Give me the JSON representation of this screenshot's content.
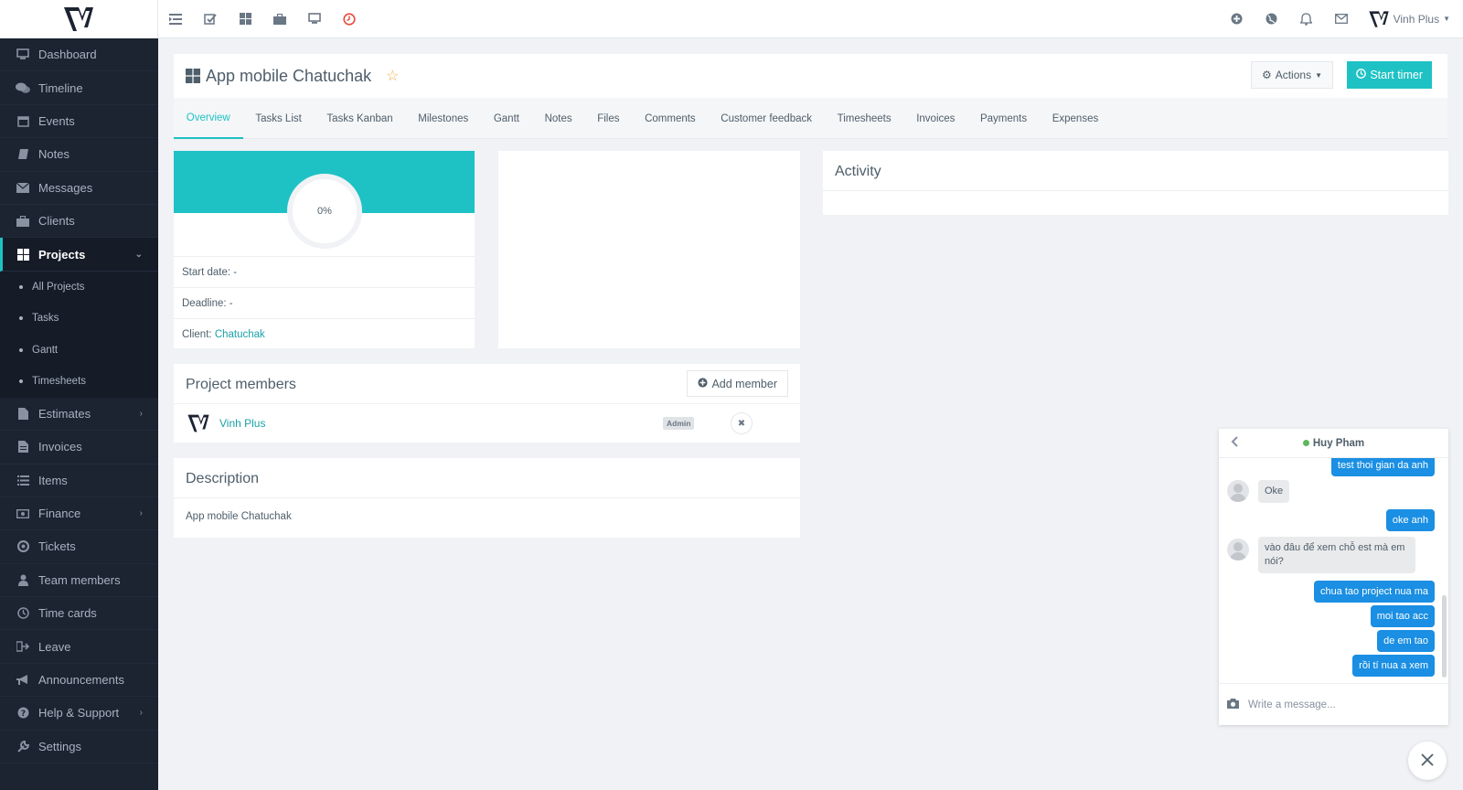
{
  "user": {
    "name": "Vinh Plus"
  },
  "sidebar": {
    "items": [
      {
        "label": "Dashboard",
        "icon": "monitor-icon"
      },
      {
        "label": "Timeline",
        "icon": "comments-icon"
      },
      {
        "label": "Events",
        "icon": "calendar-icon"
      },
      {
        "label": "Notes",
        "icon": "book-icon"
      },
      {
        "label": "Messages",
        "icon": "envelope-icon"
      },
      {
        "label": "Clients",
        "icon": "briefcase-icon"
      },
      {
        "label": "Projects",
        "icon": "grid-icon"
      }
    ],
    "sub_items": [
      "All Projects",
      "Tasks",
      "Gantt",
      "Timesheets"
    ],
    "items_after": [
      {
        "label": "Estimates",
        "icon": "file-icon"
      },
      {
        "label": "Invoices",
        "icon": "file-text-icon"
      },
      {
        "label": "Items",
        "icon": "list-icon"
      },
      {
        "label": "Finance",
        "icon": "money-icon"
      },
      {
        "label": "Tickets",
        "icon": "lifebuoy-icon"
      },
      {
        "label": "Team members",
        "icon": "user-icon"
      },
      {
        "label": "Time cards",
        "icon": "clock-icon"
      },
      {
        "label": "Leave",
        "icon": "signout-icon"
      },
      {
        "label": "Announcements",
        "icon": "bullhorn-icon"
      },
      {
        "label": "Help & Support",
        "icon": "question-icon"
      },
      {
        "label": "Settings",
        "icon": "wrench-icon"
      }
    ]
  },
  "project": {
    "title": "App mobile Chatuchak",
    "actions_label": "Actions",
    "start_timer_label": "Start timer"
  },
  "tabs": [
    "Overview",
    "Tasks List",
    "Tasks Kanban",
    "Milestones",
    "Gantt",
    "Notes",
    "Files",
    "Comments",
    "Customer feedback",
    "Timesheets",
    "Invoices",
    "Payments",
    "Expenses"
  ],
  "overview": {
    "progress": "0%",
    "start_date_label": "Start date:",
    "start_date_value": "-",
    "deadline_label": "Deadline:",
    "deadline_value": "-",
    "client_label": "Client:",
    "client_value": "Chatuchak"
  },
  "activity": {
    "title": "Activity"
  },
  "members": {
    "title": "Project members",
    "add_label": "Add member",
    "list": [
      {
        "name": "Vinh Plus",
        "role": "Admin"
      }
    ]
  },
  "description": {
    "title": "Description",
    "text": "App mobile Chatuchak"
  },
  "chat": {
    "contact": "Huy Pham",
    "placeholder": "Write a message...",
    "messages": [
      {
        "dir": "out",
        "text": "test thoi gian da anh"
      },
      {
        "dir": "in",
        "text": "Oke"
      },
      {
        "dir": "out",
        "text": "oke anh"
      },
      {
        "dir": "in",
        "text": "vào đâu để xem chỗ est mà em nói?"
      },
      {
        "dir": "out",
        "text": "chua tao project nua ma"
      },
      {
        "dir": "out",
        "text": "moi tao acc"
      },
      {
        "dir": "out",
        "text": "de em tao"
      },
      {
        "dir": "out",
        "text": "rồi tí nua a xem"
      }
    ]
  }
}
